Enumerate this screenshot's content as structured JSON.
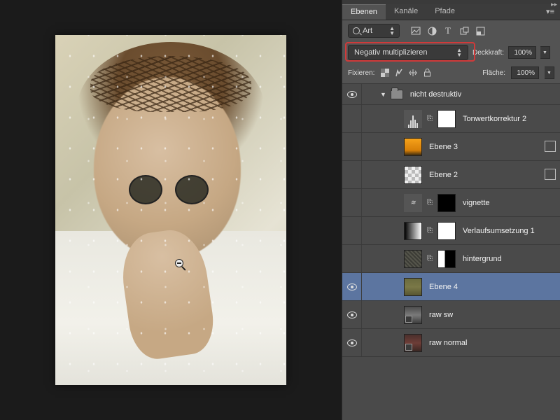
{
  "tabs": {
    "layers": "Ebenen",
    "channels": "Kanäle",
    "paths": "Pfade"
  },
  "filter": {
    "kind": "Art"
  },
  "filter_icons": [
    "image-icon",
    "adjustment-icon",
    "type-icon",
    "shape-icon",
    "smartobject-icon"
  ],
  "blend": {
    "mode": "Negativ multiplizieren",
    "opacity_label": "Deckkraft:",
    "opacity": "100%"
  },
  "lock": {
    "label": "Fixieren:",
    "fill_label": "Fläche:",
    "fill": "100%"
  },
  "group": {
    "name": "nicht destruktiv"
  },
  "layers": [
    {
      "name": "Tonwertkorrektur 2",
      "visible": false,
      "type": "adjust-levels"
    },
    {
      "name": "Ebene 3",
      "visible": false,
      "type": "orange"
    },
    {
      "name": "Ebene 2",
      "visible": false,
      "type": "checker"
    },
    {
      "name": "vignette",
      "visible": false,
      "type": "fx-black"
    },
    {
      "name": "Verlaufsumsetzung 1",
      "visible": false,
      "type": "grad-map"
    },
    {
      "name": "hintergrund",
      "visible": false,
      "type": "noise-split"
    },
    {
      "name": "Ebene 4",
      "visible": true,
      "type": "olive",
      "selected": true
    },
    {
      "name": "raw sw",
      "visible": true,
      "type": "raw-sw"
    },
    {
      "name": "raw normal",
      "visible": true,
      "type": "raw-normal"
    }
  ]
}
